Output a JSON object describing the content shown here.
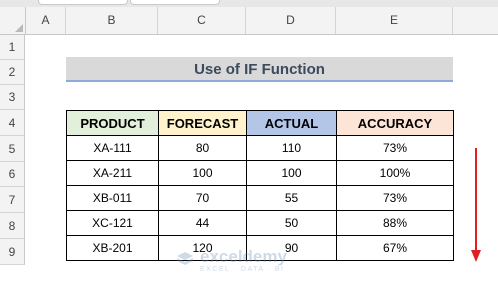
{
  "columns": [
    "A",
    "B",
    "C",
    "D",
    "E"
  ],
  "rows": [
    "1",
    "2",
    "3",
    "4",
    "5",
    "6",
    "7",
    "8",
    "9"
  ],
  "title": "Use of IF Function",
  "table": {
    "headers": [
      "PRODUCT",
      "FORECAST",
      "ACTUAL",
      "ACCURACY"
    ],
    "header_colors": [
      "#e2efda",
      "#fff2cc",
      "#b4c6e7",
      "#fce4d6"
    ],
    "rows": [
      [
        "XA-111",
        "80",
        "110",
        "73%"
      ],
      [
        "XA-211",
        "100",
        "100",
        "100%"
      ],
      [
        "XB-011",
        "70",
        "55",
        "73%"
      ],
      [
        "XC-121",
        "44",
        "50",
        "88%"
      ],
      [
        "XB-201",
        "120",
        "90",
        "67%"
      ]
    ]
  },
  "watermark": {
    "name": "exceldemy",
    "tagline": "EXCEL · DATA · BI"
  },
  "colors": {
    "arrow": "#e02020",
    "title_underline": "#8eaadb",
    "title_fill": "#d9d9d9"
  }
}
